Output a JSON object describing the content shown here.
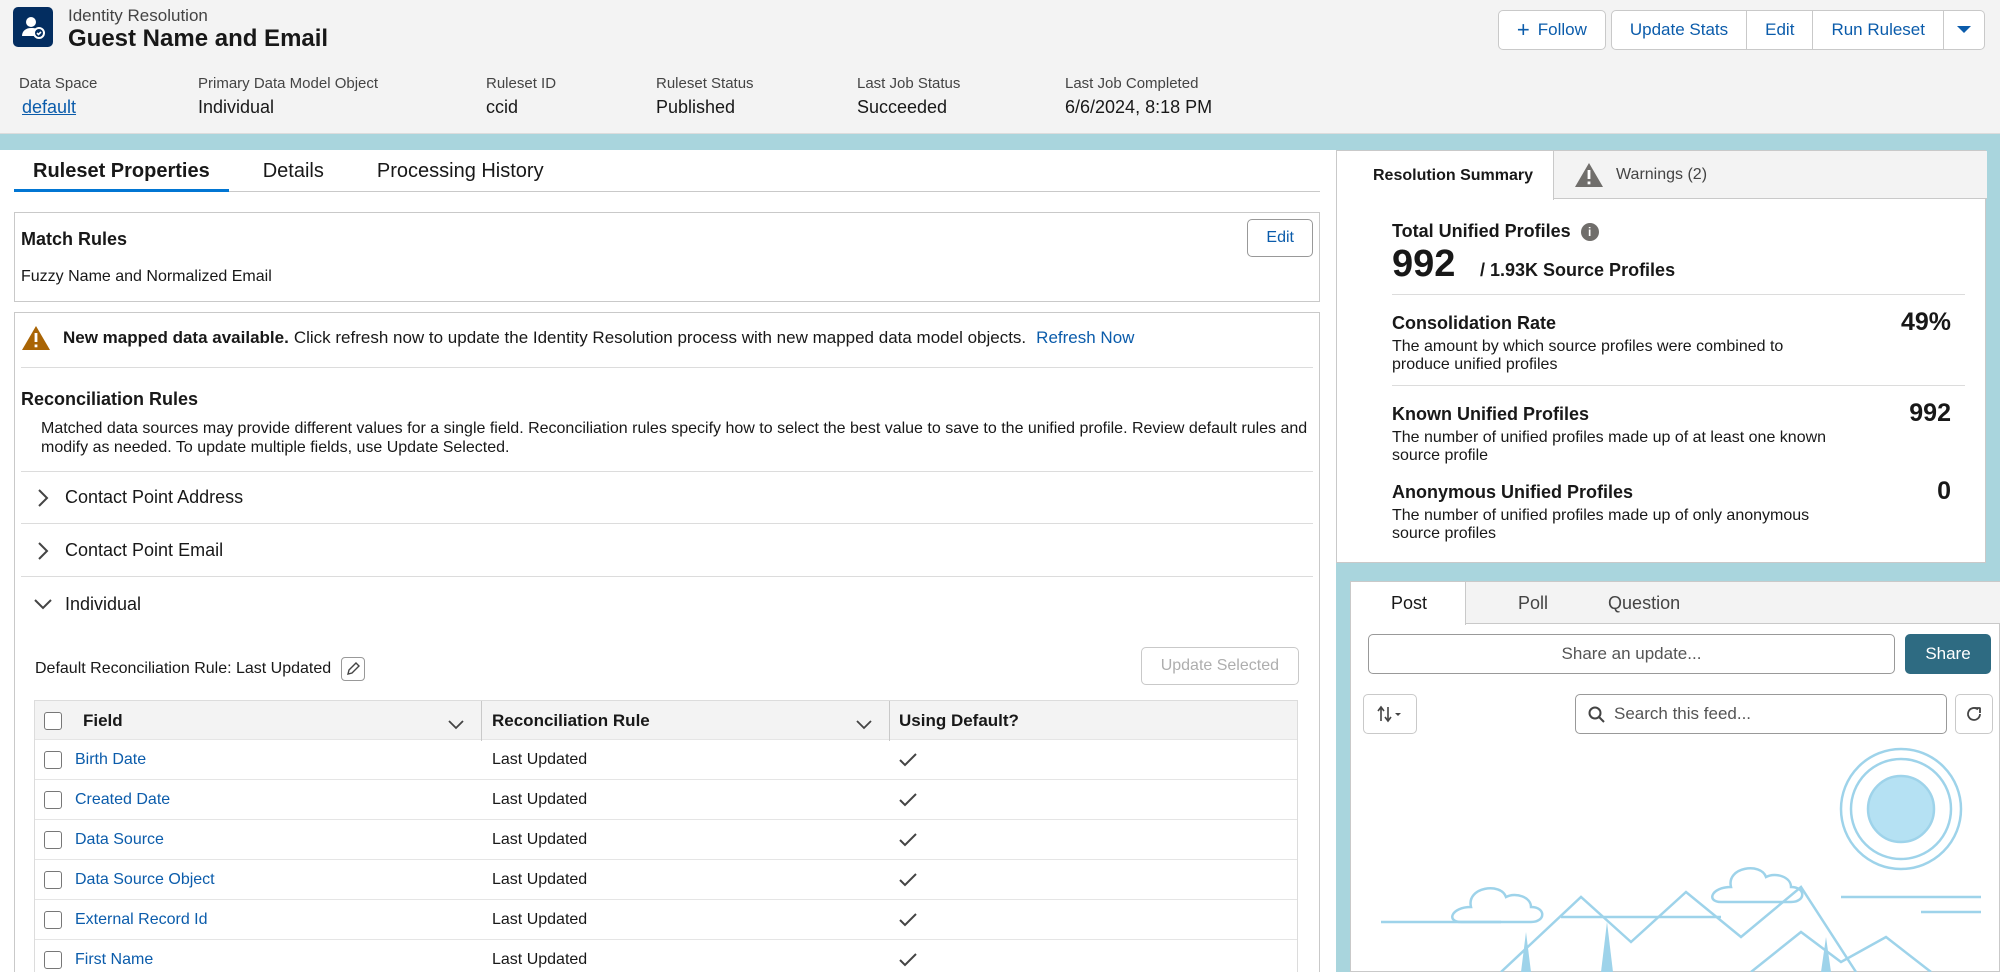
{
  "header": {
    "subtitle": "Identity Resolution",
    "title": "Guest Name and Email",
    "buttons": {
      "follow": "Follow",
      "update_stats": "Update Stats",
      "edit": "Edit",
      "run_ruleset": "Run Ruleset"
    },
    "fields": [
      {
        "label": "Data Space",
        "value": "default"
      },
      {
        "label": "Primary Data Model Object",
        "value": "Individual"
      },
      {
        "label": "Ruleset ID",
        "value": "ccid"
      },
      {
        "label": "Ruleset Status",
        "value": "Published"
      },
      {
        "label": "Last Job Status",
        "value": "Succeeded"
      },
      {
        "label": "Last Job Completed",
        "value": "6/6/2024, 8:18 PM"
      }
    ]
  },
  "tabs": [
    "Ruleset Properties",
    "Details",
    "Processing History"
  ],
  "match_rules": {
    "title": "Match Rules",
    "edit": "Edit",
    "text": "Fuzzy Name and Normalized Email"
  },
  "warning": {
    "bold": "New mapped data available.",
    "text": "Click refresh now to update the Identity Resolution process with new mapped data model objects.",
    "link": "Refresh Now"
  },
  "reconciliation": {
    "title": "Reconciliation Rules",
    "desc": "Matched data sources may provide different values for a single field. Reconciliation rules specify how to select the best value to save to the unified profile. Review default rules and modify as needed. To update multiple fields, use Update Selected.",
    "sections": [
      "Contact Point Address",
      "Contact Point Email",
      "Individual"
    ],
    "default_rule": "Default Reconciliation Rule: Last Updated",
    "update_selected": "Update Selected",
    "columns": [
      "Field",
      "Reconciliation Rule",
      "Using Default?"
    ],
    "rows": [
      {
        "field": "Birth Date",
        "rule": "Last Updated"
      },
      {
        "field": "Created Date",
        "rule": "Last Updated"
      },
      {
        "field": "Data Source",
        "rule": "Last Updated"
      },
      {
        "field": "Data Source Object",
        "rule": "Last Updated"
      },
      {
        "field": "External Record Id",
        "rule": "Last Updated"
      },
      {
        "field": "First Name",
        "rule": "Last Updated"
      }
    ]
  },
  "summary": {
    "tabs": [
      "Resolution Summary",
      "Warnings (2)"
    ],
    "total_label": "Total Unified Profiles",
    "total_value": "992",
    "source_profiles": "/ 1.93K Source Profiles",
    "metrics": [
      {
        "label": "Consolidation Rate",
        "desc": "The amount by which source profiles were combined to produce unified profiles",
        "value": "49%"
      },
      {
        "label": "Known Unified Profiles",
        "desc": "The number of unified profiles made up of at least one known source profile",
        "value": "992"
      },
      {
        "label": "Anonymous Unified Profiles",
        "desc": "The number of unified profiles made up of only anonymous source profiles",
        "value": "0"
      }
    ]
  },
  "feed": {
    "tabs": [
      "Post",
      "Poll",
      "Question"
    ],
    "share_placeholder": "Share an update...",
    "share_button": "Share",
    "search_placeholder": "Search this feed..."
  }
}
